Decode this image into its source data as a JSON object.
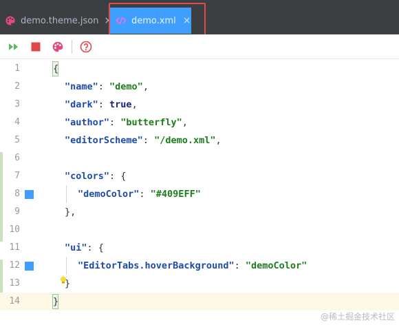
{
  "tabs": [
    {
      "label": "demo.theme.json",
      "active": false,
      "icon": "palette-icon"
    },
    {
      "label": "demo.xml",
      "active": true,
      "icon": "code-icon"
    }
  ],
  "tab_close": "×",
  "toolbar": {
    "items": [
      "run-icon",
      "stop-icon",
      "palette-icon",
      "help-icon"
    ]
  },
  "colors": {
    "accent": "#409EFF",
    "highlight_box": "#E04B4B",
    "tabbar_bg": "#3C3F41"
  },
  "editor": {
    "lines": [
      {
        "n": "1"
      },
      {
        "n": "2"
      },
      {
        "n": "3"
      },
      {
        "n": "4"
      },
      {
        "n": "5"
      },
      {
        "n": "6"
      },
      {
        "n": "7"
      },
      {
        "n": "8"
      },
      {
        "n": "9"
      },
      {
        "n": "10"
      },
      {
        "n": "11"
      },
      {
        "n": "12"
      },
      {
        "n": "13"
      },
      {
        "n": "14"
      }
    ],
    "code": {
      "l1": "{",
      "l2_key": "\"name\"",
      "l2_val": "\"demo\"",
      "l3_key": "\"dark\"",
      "l3_val": "true",
      "l4_key": "\"author\"",
      "l4_val": "\"butterfly\"",
      "l5_key": "\"editorScheme\"",
      "l5_val": "\"/demo.xml\"",
      "l7_key": "\"colors\"",
      "l8_key": "\"demoColor\"",
      "l8_val": "\"#409EFF\"",
      "l9": "},",
      "l11_key": "\"ui\"",
      "l12_key": "\"EditorTabs.hoverBackground\"",
      "l12_val": "\"demoColor\"",
      "l13": "}",
      "l14": "}"
    }
  },
  "watermark": "@稀土掘金技术社区"
}
